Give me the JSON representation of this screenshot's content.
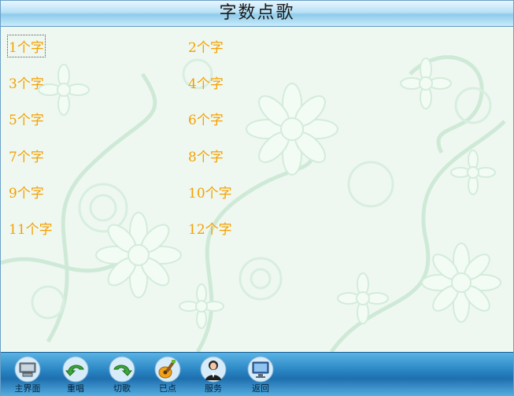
{
  "window": {
    "title": "字数点歌"
  },
  "items": [
    {
      "label": "1个字",
      "selected": true
    },
    {
      "label": "2个字"
    },
    {
      "label": "3个字"
    },
    {
      "label": "4个字"
    },
    {
      "label": "5个字"
    },
    {
      "label": "6个字"
    },
    {
      "label": "7个字"
    },
    {
      "label": "8个字"
    },
    {
      "label": "9个字"
    },
    {
      "label": "10个字"
    },
    {
      "label": "11个字"
    },
    {
      "label": "12个字"
    }
  ],
  "toolbar": {
    "main": "主界面",
    "replay": "重唱",
    "skip": "切歌",
    "selected": "已点",
    "service": "服务",
    "back": "返回"
  },
  "colors": {
    "item_text": "#f5a000",
    "toolbar": "#2b86c4",
    "title_bar": "#b9e2f7"
  }
}
